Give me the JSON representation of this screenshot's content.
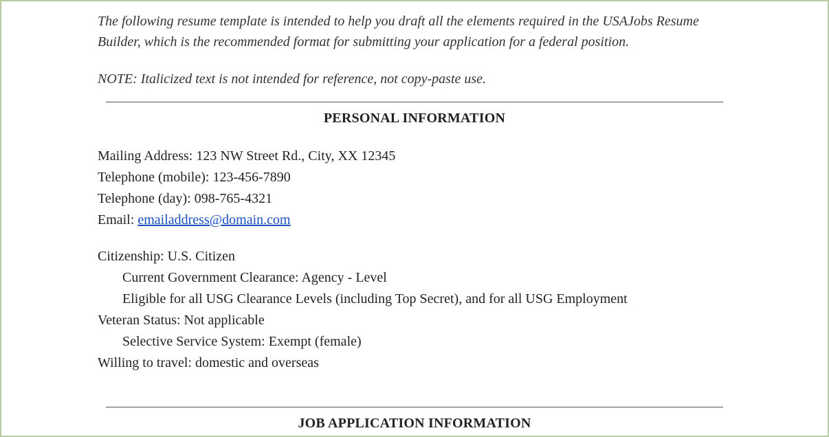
{
  "intro": "The following resume template is intended to help you draft all the elements required in the USAJobs Resume Builder, which is the recommended format for submitting your application for a federal position.",
  "note": "NOTE: Italicized text is not intended for reference, not copy-paste use.",
  "sections": {
    "personal_heading": "PERSONAL INFORMATION",
    "job_app_heading": "JOB APPLICATION INFORMATION"
  },
  "personal": {
    "mailing_label": "Mailing Address: ",
    "mailing_value": "123 NW Street Rd., City, XX 12345",
    "tel_mobile_label": "Telephone (mobile): ",
    "tel_mobile_value": "123-456-7890",
    "tel_day_label": "Telephone (day): ",
    "tel_day_value": "098-765-4321",
    "email_label": "Email: ",
    "email_value": "emailaddress@domain.com",
    "citizenship_label": "Citizenship: ",
    "citizenship_value": "U.S. Citizen",
    "clearance_line": "Current Government Clearance:  Agency - Level",
    "eligibility_line": "Eligible for all USG Clearance Levels (including Top Secret), and for all USG Employment",
    "veteran_label": "Veteran Status: ",
    "veteran_value": "Not applicable",
    "selective_service_line": "Selective Service System: Exempt (female)",
    "travel_label": "Willing to travel: ",
    "travel_value": "domestic and overseas"
  }
}
